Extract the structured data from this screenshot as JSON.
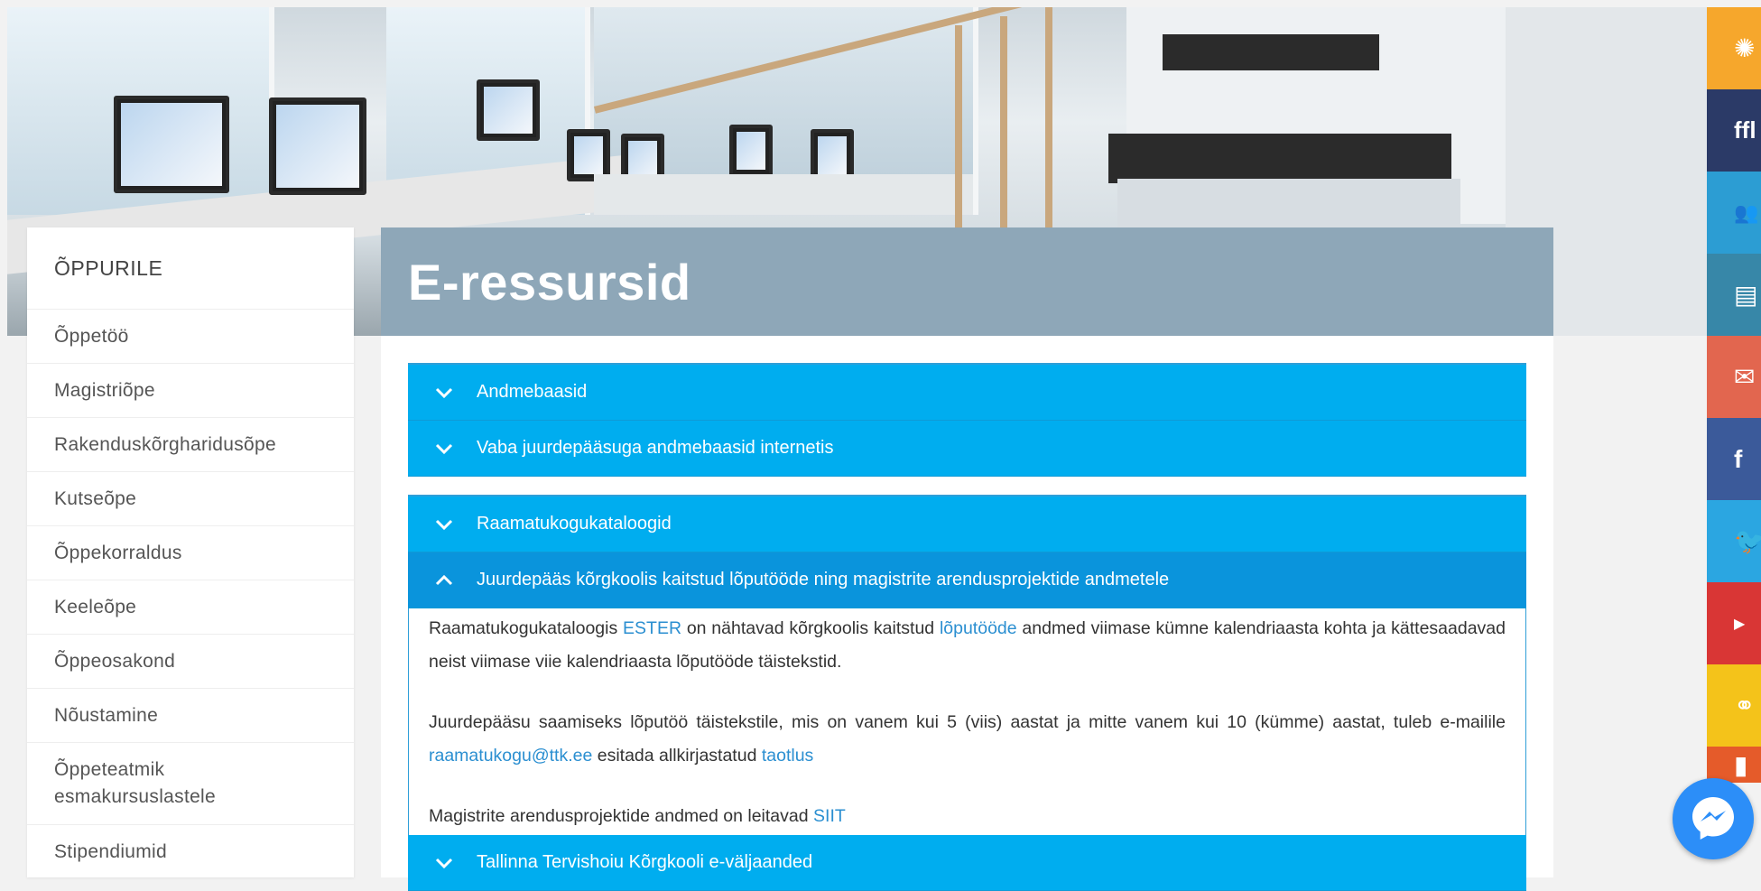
{
  "sidebar": {
    "heading": "ÕPPURILE",
    "items": [
      {
        "label": "Õppetöö"
      },
      {
        "label": "Magistriõpe"
      },
      {
        "label": "Rakenduskõrgharidusõpe"
      },
      {
        "label": "Kutseõpe"
      },
      {
        "label": "Õppekorraldus"
      },
      {
        "label": "Keeleõpe"
      },
      {
        "label": "Õppeosakond"
      },
      {
        "label": "Nõustamine"
      },
      {
        "label": "Õppeteatmik esmakursuslastele"
      },
      {
        "label": "Stipendiumid"
      }
    ]
  },
  "page": {
    "title": "E-ressursid"
  },
  "accordion1": [
    {
      "label": "Andmebaasid",
      "icon": "chevron-down-icon"
    },
    {
      "label": "Vaba juurdepääsuga andmebaasid internetis",
      "icon": "chevron-down-icon"
    }
  ],
  "accordion2": [
    {
      "label": "Raamatukogukataloogid",
      "icon": "chevron-down-icon"
    },
    {
      "label": "Juurdepääs kõrgkoolis kaitstud lõputööde ning magistrite arendusprojektide andmetele",
      "icon": "chevron-up-icon"
    },
    {
      "label": "Tallinna Tervishoiu Kõrgkooli e-väljaanded",
      "icon": "chevron-down-icon"
    }
  ],
  "content": {
    "p1": {
      "t1": "Raamatukogukataloogis ",
      "link1": "ESTER",
      "t2": " on nähtavad kõrgkoolis kaitstud ",
      "link2": "lõputööde",
      "t3": " andmed viimase kümne kalendriaasta kohta ja kättesaadavad neist viimase viie kalendriaasta lõputööde täistekstid."
    },
    "p2": {
      "t1": "Juurdepääsu saamiseks lõputöö täistekstile, mis on vanem kui 5 (viis) aastat ja mitte vanem kui 10 (kümme) aastat, tuleb e-mailile ",
      "link1": "raamatukogu@ttk.ee",
      "t2": " esitada allkirjastatud ",
      "link2": "taotlus"
    },
    "p3": {
      "t1": "Magistrite arendusprojektide andmed on leitavad ",
      "link1": "SIIT"
    }
  },
  "social": [
    {
      "name": "sun-icon",
      "color": "#f6a72c"
    },
    {
      "name": "edu-logo-icon",
      "color": "#2b3a67"
    },
    {
      "name": "people-icon",
      "color": "#2c9dd3"
    },
    {
      "name": "document-icon",
      "color": "#3787a8"
    },
    {
      "name": "mail-icon",
      "color": "#e2664f"
    },
    {
      "name": "facebook-icon",
      "color": "#3b5a9a"
    },
    {
      "name": "twitter-icon",
      "color": "#2ba6e1"
    },
    {
      "name": "youtube-icon",
      "color": "#d93635"
    },
    {
      "name": "link-icon",
      "color": "#f4c31a"
    },
    {
      "name": "office-icon",
      "color": "#e55b2a"
    }
  ],
  "messenger": {
    "icon": "messenger-icon",
    "color": "#2c8ef8"
  }
}
